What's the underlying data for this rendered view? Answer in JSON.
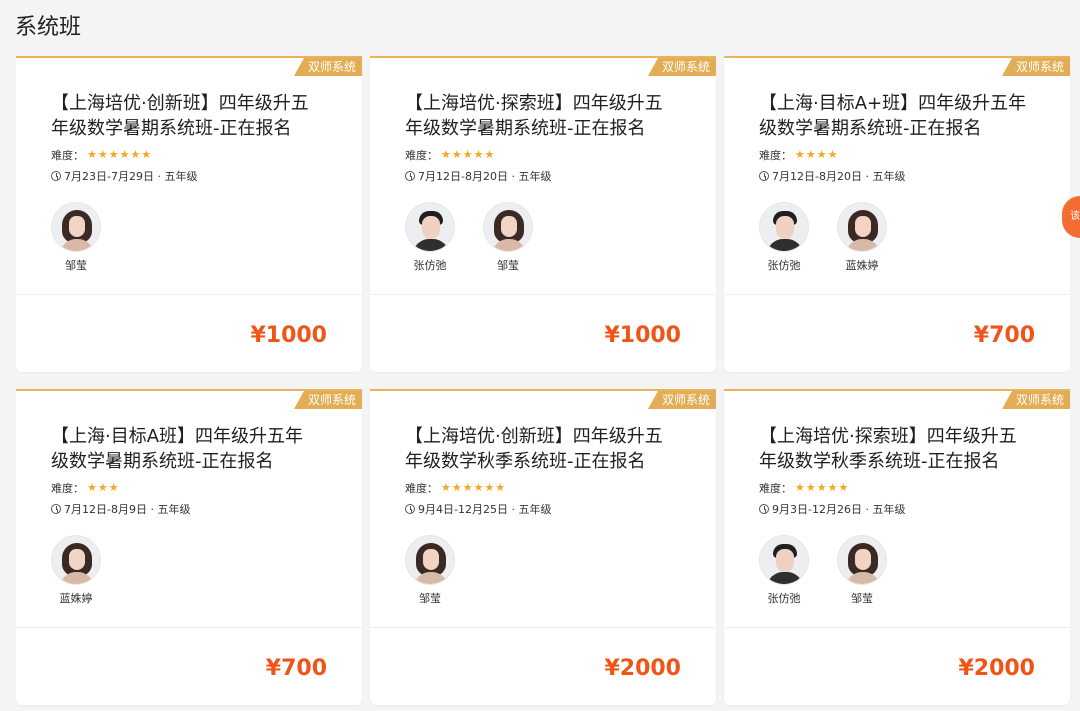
{
  "section": {
    "title": "系统班"
  },
  "floating_button": {
    "label": "该"
  },
  "cards": [
    {
      "tag": "双师系统",
      "title": "【上海培优·创新班】四年级升五年级数学暑期系统班-正在报名",
      "difficulty_label": "难度：",
      "stars": "★★★★★★",
      "date": "7月23日-7月29日 · 五年级",
      "teachers": [
        "邹莹"
      ],
      "price": "¥1000"
    },
    {
      "tag": "双师系统",
      "title": "【上海培优·探索班】四年级升五年级数学暑期系统班-正在报名",
      "difficulty_label": "难度：",
      "stars": "★★★★★",
      "date": "7月12日-8月20日 · 五年级",
      "teachers": [
        "张仿弛",
        "邹莹"
      ],
      "price": "¥1000"
    },
    {
      "tag": "双师系统",
      "title": "【上海·目标A+班】四年级升五年级数学暑期系统班-正在报名",
      "difficulty_label": "难度：",
      "stars": "★★★★",
      "date": "7月12日-8月20日 · 五年级",
      "teachers": [
        "张仿弛",
        "蓝姝婷"
      ],
      "price": "¥700"
    },
    {
      "tag": "双师系统",
      "title": "【上海·目标A班】四年级升五年级数学暑期系统班-正在报名",
      "difficulty_label": "难度：",
      "stars": "★★★",
      "date": "7月12日-8月9日 · 五年级",
      "teachers": [
        "蓝姝婷"
      ],
      "price": "¥700"
    },
    {
      "tag": "双师系统",
      "title": "【上海培优·创新班】四年级升五年级数学秋季系统班-正在报名",
      "difficulty_label": "难度：",
      "stars": "★★★★★★",
      "date": "9月4日-12月25日 · 五年级",
      "teachers": [
        "邹莹"
      ],
      "price": "¥2000"
    },
    {
      "tag": "双师系统",
      "title": "【上海培优·探索班】四年级升五年级数学秋季系统班-正在报名",
      "difficulty_label": "难度：",
      "stars": "★★★★★",
      "date": "9月3日-12月26日 · 五年级",
      "teachers": [
        "张仿弛",
        "邹莹"
      ],
      "price": "¥2000"
    }
  ],
  "colors": {
    "accent_gold": "#e2ad55",
    "price_orange": "#f05518",
    "star": "#f5a623"
  }
}
